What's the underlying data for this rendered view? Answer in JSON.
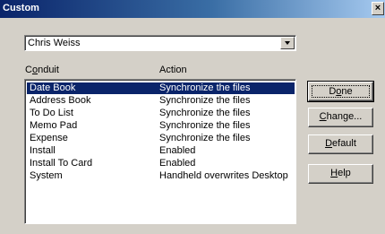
{
  "window": {
    "title": "Custom",
    "close_glyph": "×"
  },
  "user_select": {
    "value": "Chris Weiss"
  },
  "columns": {
    "conduit": [
      "C",
      "o",
      "nduit"
    ],
    "action": "Action"
  },
  "rows": [
    {
      "conduit": "Date Book",
      "action": "Synchronize the files",
      "selected": true
    },
    {
      "conduit": "Address Book",
      "action": "Synchronize the files"
    },
    {
      "conduit": "To Do List",
      "action": "Synchronize the files"
    },
    {
      "conduit": "Memo Pad",
      "action": "Synchronize the files"
    },
    {
      "conduit": "Expense",
      "action": "Synchronize the files"
    },
    {
      "conduit": "Install",
      "action": "Enabled"
    },
    {
      "conduit": "Install To Card",
      "action": "Enabled"
    },
    {
      "conduit": "System",
      "action": "Handheld overwrites Desktop"
    }
  ],
  "buttons": {
    "done": [
      "D",
      "o",
      "ne"
    ],
    "change": [
      "",
      "C",
      "hange..."
    ],
    "default": [
      "",
      "D",
      "efault"
    ],
    "help": [
      "",
      "H",
      "elp"
    ]
  },
  "colors": {
    "titlebar": "#0a246a",
    "selection": "#0a246a",
    "face": "#d4d0c8"
  }
}
